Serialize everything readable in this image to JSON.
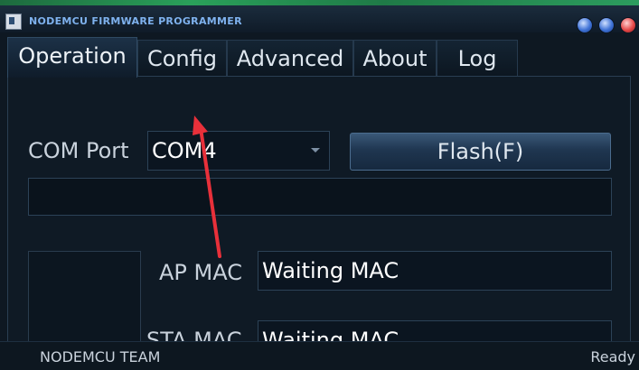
{
  "window": {
    "title": "NODEMCU FIRMWARE PROGRAMMER"
  },
  "tabs": [
    {
      "label": "Operation",
      "active": true
    },
    {
      "label": "Config",
      "active": false
    },
    {
      "label": "Advanced",
      "active": false
    },
    {
      "label": "About",
      "active": false
    },
    {
      "label": "Log",
      "active": false
    }
  ],
  "operation": {
    "com_port_label": "COM Port",
    "com_port_value": "COM4",
    "flash_button_label": "Flash(F)",
    "progress_fraction": 0,
    "ap_mac_label": "AP MAC",
    "ap_mac_value": "Waiting MAC",
    "sta_mac_label": "STA MAC",
    "sta_mac_value": "Waiting MAC"
  },
  "status": {
    "left": "NODEMCU TEAM",
    "right": "Ready"
  },
  "colors": {
    "accent": "#2a6fb0",
    "annotation_arrow": "#e8303a",
    "title_text": "#7fb2ee"
  }
}
